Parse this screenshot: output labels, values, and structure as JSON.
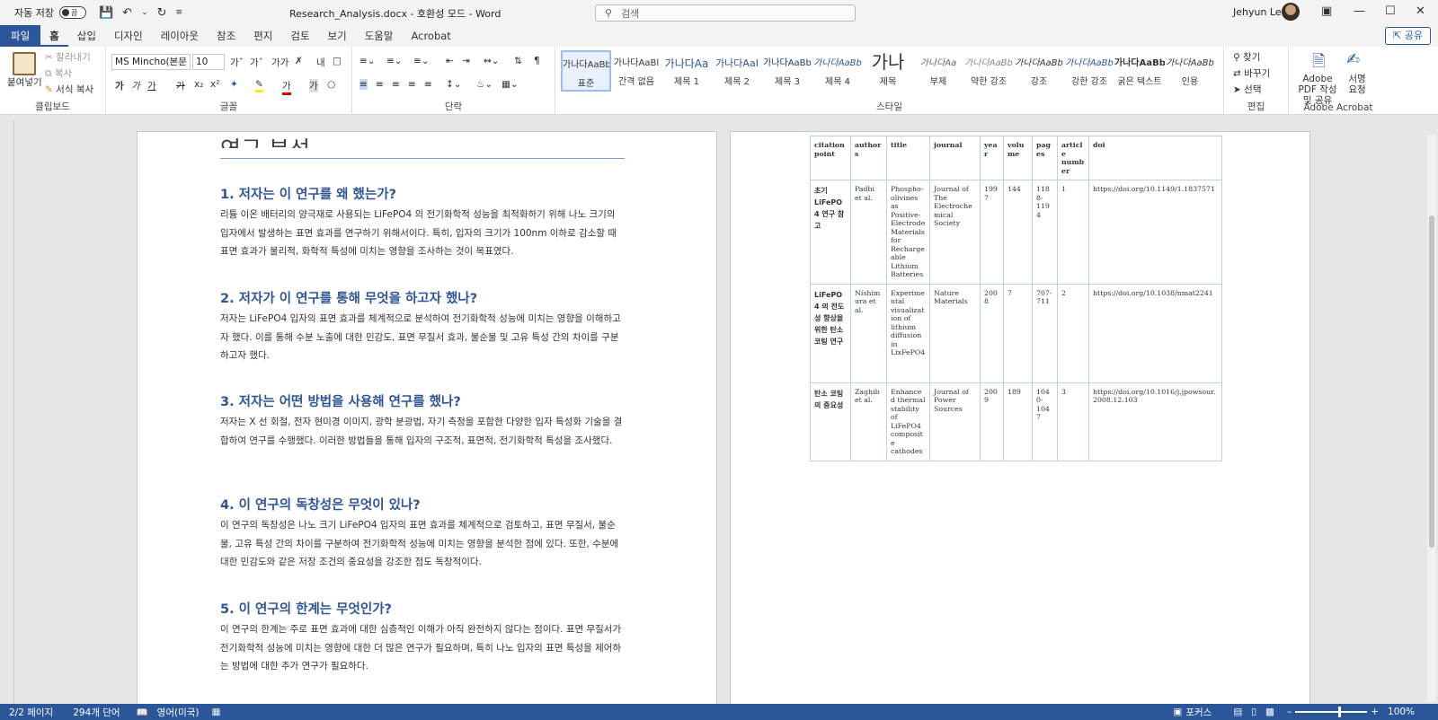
{
  "titlebar": {
    "autosave": "자동 저장",
    "toggle_state": "끔",
    "doc_title": "Research_Analysis.docx - 호환성 모드 - Word",
    "search_placeholder": "검색",
    "user": "Jehyun Lee"
  },
  "tabs": [
    "파일",
    "홈",
    "삽입",
    "디자인",
    "레이아웃",
    "참조",
    "편지",
    "검토",
    "보기",
    "도움말",
    "Acrobat"
  ],
  "share": "공유",
  "ribbon": {
    "clipboard": {
      "label": "클립보드",
      "paste": "붙여넣기",
      "cut": "잘라내기",
      "copy": "복사",
      "format_painter": "서식 복사"
    },
    "font": {
      "label": "글꼴",
      "font_name": "MS Mincho(본문",
      "font_size": "10"
    },
    "paragraph": {
      "label": "단락"
    },
    "styles": {
      "label": "스타일",
      "items": [
        {
          "preview": "가나다AaBb",
          "name": "표준"
        },
        {
          "preview": "가나다AaBl",
          "name": "간격 없음"
        },
        {
          "preview": "가나다Aa",
          "name": "제목 1"
        },
        {
          "preview": "가나다AaI",
          "name": "제목 2"
        },
        {
          "preview": "가나다AaBb",
          "name": "제목 3"
        },
        {
          "preview": "가나다AaBb",
          "name": "제목 4"
        },
        {
          "preview": "가나",
          "name": "제목"
        },
        {
          "preview": "가나다Aa",
          "name": "부제"
        },
        {
          "preview": "가나다AaBb",
          "name": "약한 강조"
        },
        {
          "preview": "가나다AaBb",
          "name": "강조"
        },
        {
          "preview": "가나다AaBb",
          "name": "강한 강조"
        },
        {
          "preview": "가나다AaBb",
          "name": "굵은 텍스트"
        },
        {
          "preview": "가나다AaBb",
          "name": "인용"
        }
      ]
    },
    "editing": {
      "label": "편집",
      "find": "찾기",
      "replace": "바꾸기",
      "select": "선택"
    },
    "acrobat": {
      "label": "Adobe Acrobat",
      "create": "Adobe PDF 작성 및 공유",
      "sign": "서명 요청"
    }
  },
  "page1": {
    "title": "연구 분석",
    "sections": [
      {
        "heading": "1. 저자는 이 연구를 왜 했는가?",
        "body": "리튬 이온 배터리의 양극재로 사용되는 LiFePO4 의 전기화학적 성능을 최적화하기 위해 나노 크기의 입자에서 발생하는 표면 효과를 연구하기 위해서이다. 특히, 입자의 크기가 100nm 이하로 감소할 때 표면 효과가 물리적, 화학적 특성에 미치는 영향을 조사하는 것이 목표였다."
      },
      {
        "heading": "2. 저자가 이 연구를 통해 무엇을 하고자 했나?",
        "body": "저자는 LiFePO4 입자의 표면 효과를 체계적으로 분석하여 전기화학적 성능에 미치는 영향을 이해하고자 했다. 이를 통해 수분 노출에 대한 민감도, 표면 무질서 효과, 불순물 및 고유 특성 간의 차이를 구분하고자 했다."
      },
      {
        "heading": "3. 저자는 어떤 방법을 사용해 연구를 했나?",
        "body": "저자는 X 선 회절, 전자 현미경 이미지, 광학 분광법, 자기 측정을 포함한 다양한 입자 특성화 기술을 결합하여 연구를 수행했다. 이러한 방법들을 통해 입자의 구조적, 표면적, 전기화학적 특성을 조사했다."
      },
      {
        "heading": "4. 이 연구의 독창성은 무엇이 있나?",
        "body": "이 연구의 독창성은 나노 크기 LiFePO4 입자의 표면 효과를 체계적으로 검토하고, 표면 무질서, 불순물, 고유 특성 간의 차이를 구분하여 전기화학적 성능에 미치는 영향을 분석한 점에 있다. 또한, 수분에 대한 민감도와 같은 저장 조건의 중요성을 강조한 점도 독창적이다."
      },
      {
        "heading": "5. 이 연구의 한계는 무엇인가?",
        "body": "이 연구의 한계는 주로 표면 효과에 대한 심층적인 이해가 아직 완전하지 않다는 점이다. 표면 무질서가 전기화학적 성능에 미치는 영향에 대한 더 많은 연구가 필요하며, 특히 나노 입자의 표면 특성을 제어하는 방법에 대한 추가 연구가 필요하다."
      }
    ]
  },
  "table": {
    "headers": [
      "citation point",
      "authors",
      "title",
      "journal",
      "year",
      "volume",
      "pages",
      "article number",
      "doi"
    ],
    "rows": [
      [
        "초기 LiFePO4 연구 참고",
        "Padhi et al.",
        "Phospho-olivines as Positive-Electrode Materials for Rechargeable Lithium Batteries",
        "Journal of The Electrochemical Society",
        "1997",
        "144",
        "1188-1194",
        "1",
        "https://doi.org/10.1149/1.1837571"
      ],
      [
        "LiFePO4 의 전도성 향상을 위한 탄소 코팅 연구",
        "Nishimura et al.",
        "Experimental visualization of lithium diffusion in LixFePO4",
        "Nature Materials",
        "2008",
        "7",
        "707-711",
        "2",
        "https://doi.org/10.1038/nmat2241"
      ],
      [
        "탄소 코팅의 중요성",
        "Zaghib et al.",
        "Enhanced thermal stability of LiFePO4 composite cathodes",
        "Journal of Power Sources",
        "2009",
        "189",
        "1040-1047",
        "3",
        "https://doi.org/10.1016/j.jpowsour.2008.12.103"
      ]
    ]
  },
  "status": {
    "page": "2/2 페이지",
    "words": "294개 단어",
    "language": "영어(미국)",
    "focus": "포커스",
    "zoom": "100%"
  },
  "colors": {
    "accent": "#2b579a",
    "heading": "#2f5496"
  }
}
